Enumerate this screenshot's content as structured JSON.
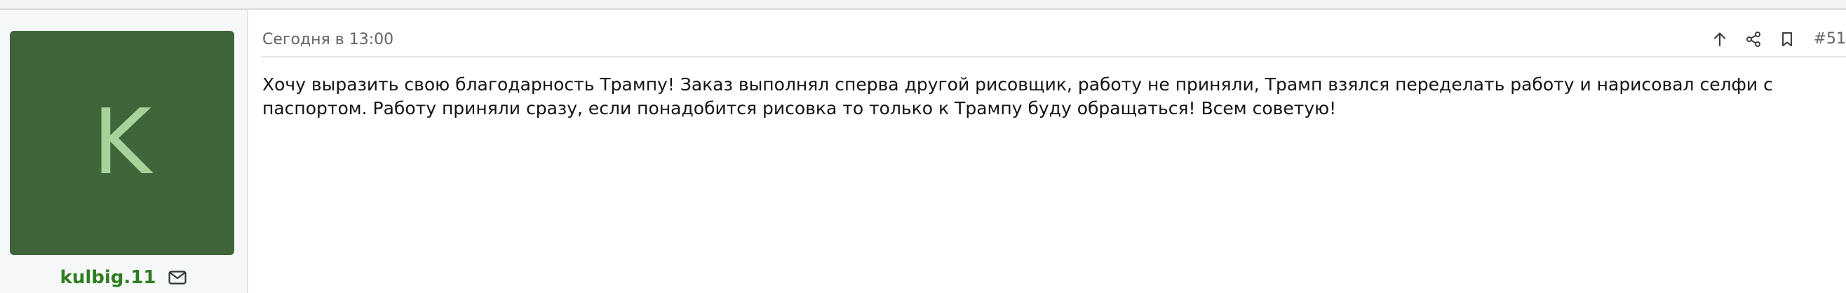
{
  "post": {
    "date": "Сегодня в 13:00",
    "number": "#51",
    "body": "Хочу выразить свою благодарность Трампу! Заказ выполнял сперва другой рисовщик, работу не приняли, Трамп взялся переделать работу и нарисовал селфи с паспортом. Работу приняли сразу, если понадобится рисовка то только к Трампу буду обращаться! Всем советую!"
  },
  "user": {
    "avatar_letter": "K",
    "name": "kulbig.11",
    "name_color": "#2e7d1e",
    "avatar_bg": "#41653a",
    "avatar_fg": "#a7d39b"
  },
  "icons": {
    "up": "arrow-up-icon",
    "share": "share-icon",
    "bookmark": "bookmark-icon",
    "mail": "envelope-icon"
  }
}
